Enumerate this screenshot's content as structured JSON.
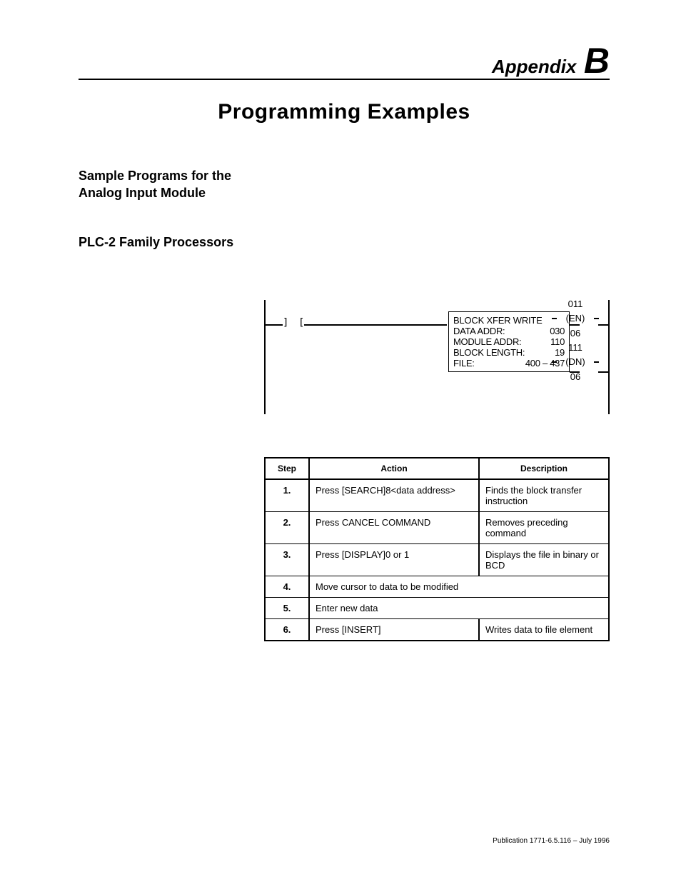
{
  "header": {
    "appendix_label": "Appendix",
    "appendix_letter": "B"
  },
  "title": "Programming Examples",
  "section_heading_line1": "Sample Programs for the",
  "section_heading_line2": "Analog Input Module",
  "subheading": "PLC-2 Family Processors",
  "ladder": {
    "block_title": "BLOCK XFER WRITE",
    "rows": [
      {
        "label": "DATA ADDR:",
        "value": "030"
      },
      {
        "label": "MODULE ADDR:",
        "value": "110"
      },
      {
        "label": "BLOCK LENGTH:",
        "value": "19"
      },
      {
        "label": "FILE:",
        "value": "400 – 437"
      }
    ],
    "outputs": {
      "top_addr": "011",
      "en_label": "EN",
      "en_bit": "06",
      "bot_addr": "111",
      "dn_label": "DN",
      "dn_bit": "06"
    }
  },
  "table": {
    "headers": {
      "step": "Step",
      "action": "Action",
      "description": "Description"
    },
    "rows": [
      {
        "step": "1.",
        "action": "Press [SEARCH]8<data address>",
        "description": "Finds the block transfer instruction"
      },
      {
        "step": "2.",
        "action": "Press CANCEL COMMAND",
        "description": "Removes preceding command"
      },
      {
        "step": "3.",
        "action": "Press [DISPLAY]0 or 1",
        "description": "Displays the file in binary or BCD"
      },
      {
        "step": "4.",
        "action": "Move cursor to data to be modified",
        "description": ""
      },
      {
        "step": "5.",
        "action": "Enter new data",
        "description": ""
      },
      {
        "step": "6.",
        "action": "Press [INSERT]",
        "description": "Writes data to file element"
      }
    ]
  },
  "footer": "Publication 1771-6.5.116 – July 1996"
}
